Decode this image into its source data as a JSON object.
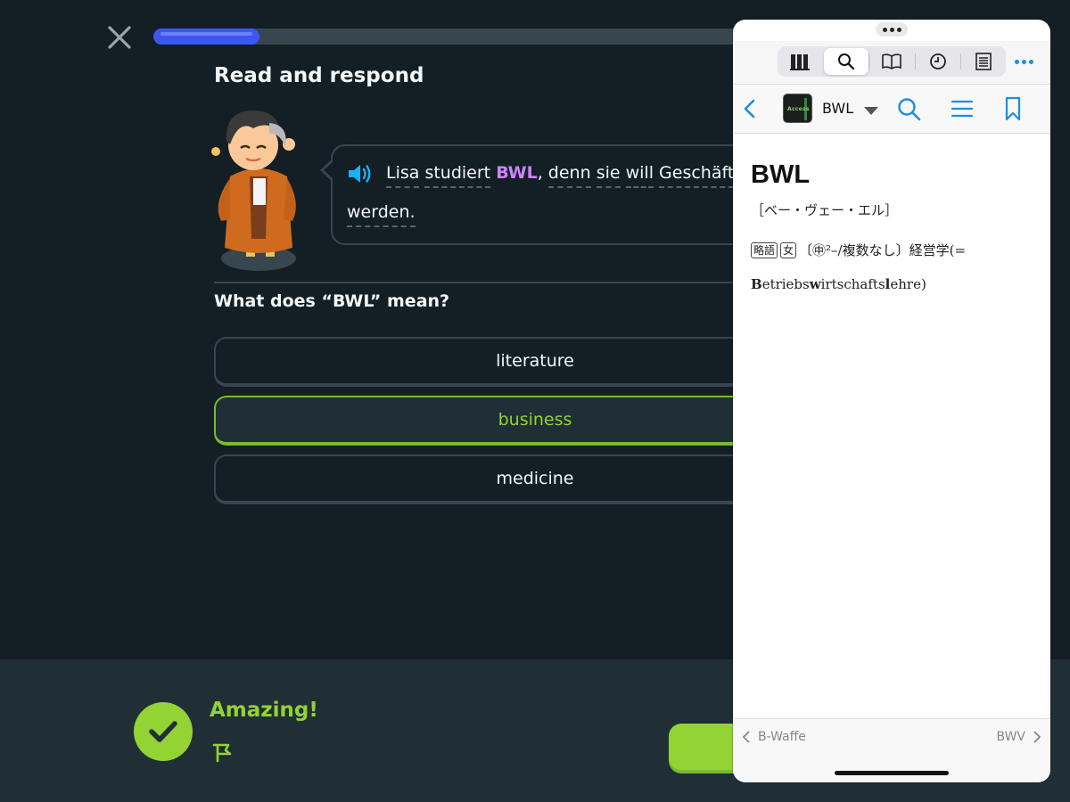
{
  "lesson": {
    "progress_percent": 17,
    "heading": "Read and respond",
    "sentence": {
      "w1": "Lisa",
      "w2": "studiert",
      "highlight": "BWL",
      "comma": ",",
      "w3": "denn",
      "w4": "sie",
      "w5": "will",
      "w6": "Geschäft",
      "line2": "werden."
    },
    "question": "What does “BWL” mean?",
    "options": [
      {
        "label": "literature",
        "selected": false
      },
      {
        "label": "business",
        "selected": true
      },
      {
        "label": "medicine",
        "selected": false
      }
    ]
  },
  "feedback": {
    "title": "Amazing!",
    "status": "correct"
  },
  "dictionary": {
    "tabs": [
      "library-icon",
      "search-icon",
      "book-icon",
      "history-icon",
      "list-icon"
    ],
    "active_tab": "search-icon",
    "logo_text": "Access",
    "entry_title": "BWL",
    "entry": {
      "headword": "BWL",
      "pronunciation": "［ベー・ヴェー・エル］",
      "tag1": "略語",
      "tag2": "女",
      "grammar": "〔㊥²–/複数なし〕経営学(=",
      "expansion_parts": [
        "B",
        "etriebs",
        "w",
        "irtschafts",
        "l",
        "ehre",
        ")"
      ]
    },
    "prev_entry": "B-Waffe",
    "next_entry": "BWV"
  },
  "colors": {
    "background": "#131f24",
    "accent_green": "#93d333",
    "progress_blue": "#3c56f5",
    "highlight_purple": "#ce82ff",
    "ios_blue": "#1c8fe0"
  }
}
